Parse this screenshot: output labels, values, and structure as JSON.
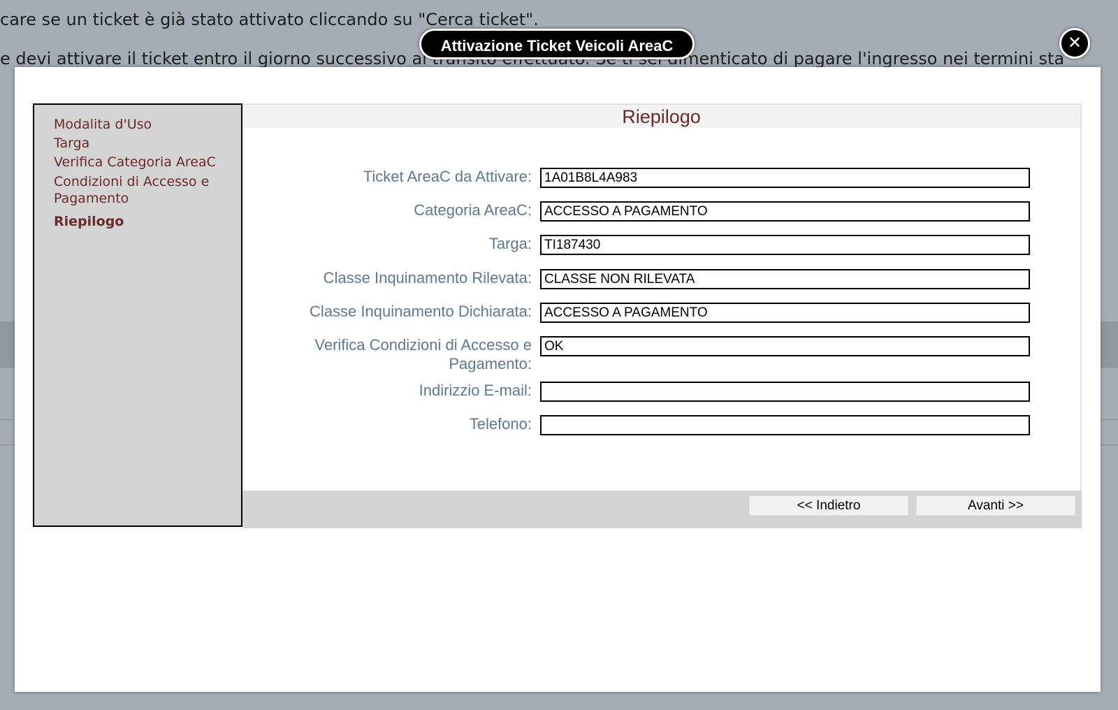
{
  "background": {
    "line1": "care se un ticket è già stato attivato cliccando su \"Cerca ticket\".",
    "line2": "e devi attivare il ticket entro il giorno successivo al transito effettuato. Se ti sei dimenticato di pagare l'ingresso nei termini sta"
  },
  "modal": {
    "title": "Attivazione Ticket Veicoli AreaC",
    "close_label": "✕"
  },
  "sidebar": {
    "items": [
      {
        "label": "Modalita d'Uso"
      },
      {
        "label": "Targa"
      },
      {
        "label": "Verifica Categoria AreaC"
      },
      {
        "label": "Condizioni di Accesso e Pagamento"
      },
      {
        "label": "Riepilogo"
      }
    ]
  },
  "panel": {
    "heading": "Riepilogo",
    "fields": [
      {
        "label": "Ticket AreaC da Attivare:",
        "value": "1A01B8L4A983"
      },
      {
        "label": "Categoria AreaC:",
        "value": "ACCESSO A PAGAMENTO"
      },
      {
        "label": "Targa:",
        "value": "TI187430"
      },
      {
        "label": "Classe Inquinamento Rilevata:",
        "value": "CLASSE NON RILEVATA"
      },
      {
        "label": "Classe Inquinamento Dichiarata:",
        "value": "ACCESSO A PAGAMENTO"
      },
      {
        "label": "Verifica Condizioni di Accesso e Pagamento:",
        "value": "OK"
      },
      {
        "label": "Indirizzio E-mail:",
        "value": ""
      },
      {
        "label": "Telefono:",
        "value": ""
      }
    ],
    "back_label": "<< Indietro",
    "next_label": "Avanti >>"
  }
}
